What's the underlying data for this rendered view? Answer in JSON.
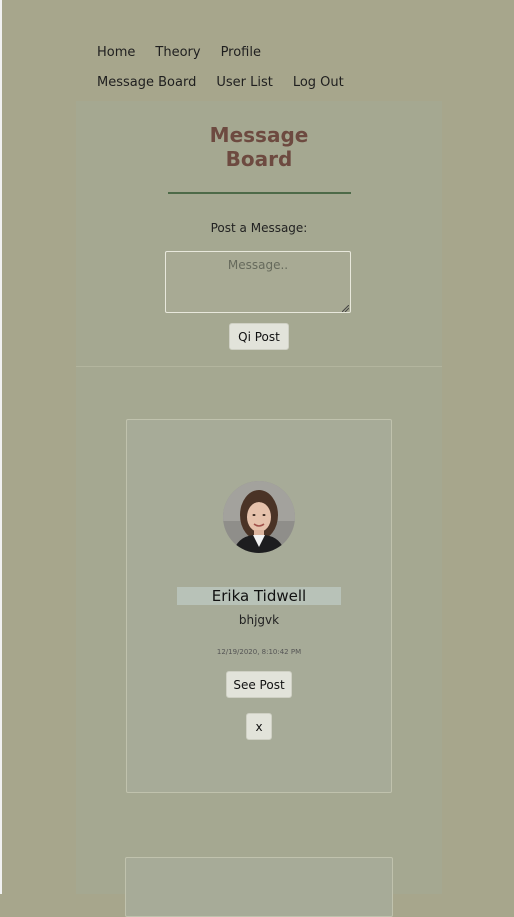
{
  "nav": {
    "items": [
      {
        "label": "Home"
      },
      {
        "label": "Theory"
      },
      {
        "label": "Profile"
      },
      {
        "label": "Message Board"
      },
      {
        "label": "User List"
      },
      {
        "label": "Log Out"
      }
    ]
  },
  "board": {
    "title": "Message Board",
    "post_label": "Post a Message:",
    "message_placeholder": "Message..",
    "post_button": "Qi Post"
  },
  "posts": [
    {
      "author": "Erika Tidwell",
      "body": "bhjgvk",
      "timestamp": "12/19/2020, 8:10:42 PM",
      "see_post_label": "See Post",
      "delete_label": "x"
    }
  ],
  "colors": {
    "background": "#a7a68c",
    "panel": "#a5a891",
    "title": "#6d4a40",
    "rule": "#4d6a48",
    "button": "#e2e3da",
    "author_highlight": "#b8c2b8"
  }
}
